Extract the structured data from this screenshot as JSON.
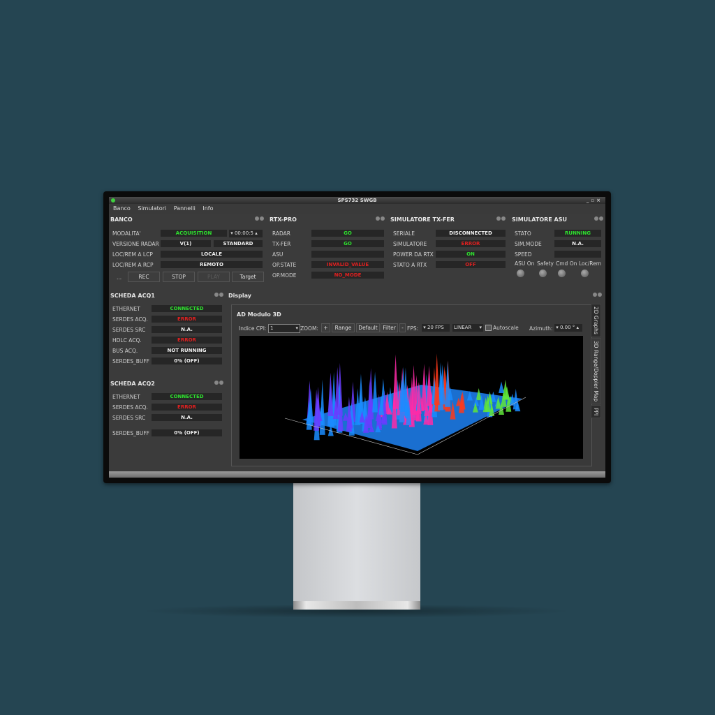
{
  "window": {
    "title": "SPS732 SWGB",
    "controls": [
      "_",
      "▫",
      "×"
    ]
  },
  "menu": [
    "Banco",
    "Simulatori",
    "Pannelli",
    "Info"
  ],
  "banco": {
    "title": "BANCO",
    "rows": [
      {
        "label": "MODALITA'",
        "value": "ACQUISITION",
        "color": "green"
      },
      {
        "label": "VERSIONE RADAR",
        "value": "V(1)",
        "value2": "STANDARD",
        "color": "white"
      },
      {
        "label": "LOC/REM A LCP",
        "value": "LOCALE",
        "color": "white"
      },
      {
        "label": "LOC/REM A RCP",
        "value": "REMOTO",
        "color": "white"
      }
    ],
    "timer": "00:00:5",
    "buttons": {
      "more": "...",
      "rec": "REC",
      "stop": "STOP",
      "play": "PLAY",
      "target": "Target"
    }
  },
  "rtx_pro": {
    "title": "RTX-PRO",
    "rows": [
      {
        "label": "RADAR",
        "value": "GO",
        "color": "green"
      },
      {
        "label": "TX-FER",
        "value": "GO",
        "color": "green"
      },
      {
        "label": "ASU",
        "value": "",
        "color": "white"
      },
      {
        "label": "OP.STATE",
        "value": "INVALID_VALUE",
        "color": "red"
      },
      {
        "label": "OP.MODE",
        "value": "NO_MODE",
        "color": "red"
      }
    ]
  },
  "sim_txfer": {
    "title": "SIMULATORE TX-FER",
    "rows": [
      {
        "label": "SERIALE",
        "value": "DISCONNECTED",
        "color": "white"
      },
      {
        "label": "SIMULATORE",
        "value": "ERROR",
        "color": "red"
      },
      {
        "label": "POWER DA RTX",
        "value": "ON",
        "color": "green"
      },
      {
        "label": "STATO A RTX",
        "value": "OFF",
        "color": "red"
      }
    ]
  },
  "sim_asu": {
    "title": "SIMULATORE ASU",
    "rows": [
      {
        "label": "STATO",
        "value": "RUNNING",
        "color": "green"
      },
      {
        "label": "SIM.MODE",
        "value": "N.A.",
        "color": "white"
      },
      {
        "label": "SPEED",
        "value": "",
        "color": "white"
      }
    ],
    "leds": [
      "ASU On",
      "Safety",
      "Cmd On",
      "Loc/Rem"
    ]
  },
  "acq1": {
    "title": "SCHEDA ACQ1",
    "rows": [
      {
        "label": "ETHERNET",
        "value": "CONNECTED",
        "color": "green"
      },
      {
        "label": "SERDES ACQ.",
        "value": "ERROR",
        "color": "red"
      },
      {
        "label": "SERDES SRC",
        "value": "N.A.",
        "color": "white"
      },
      {
        "label": "HDLC ACQ.",
        "value": "ERROR",
        "color": "red"
      },
      {
        "label": "BUS ACQ.",
        "value": "NOT RUNNING",
        "color": "white"
      },
      {
        "label": "SERDES_BUFF",
        "value": "0% (OFF)",
        "color": "white"
      }
    ]
  },
  "acq2": {
    "title": "SCHEDA ACQ2",
    "rows": [
      {
        "label": "ETHERNET",
        "value": "CONNECTED",
        "color": "green"
      },
      {
        "label": "SERDES ACQ.",
        "value": "ERROR",
        "color": "red"
      },
      {
        "label": "SERDES SRC",
        "value": "N.A.",
        "color": "white"
      },
      {
        "label": "SERDES_BUFF",
        "value": "0% (OFF)",
        "color": "white"
      }
    ]
  },
  "display": {
    "title": "Display",
    "subtitle": "AD Modulo 3D",
    "toolbar": {
      "cpi_label": "Indice CPI:",
      "cpi_value": "1",
      "zoom_label": "ZOOM:",
      "zoom_plus": "+",
      "range": "Range",
      "default": "Default",
      "filter": "Filter",
      "zoom_minus": "-",
      "fps_label": "FPS:",
      "fps_value": "20 FPS",
      "scale_value": "LINEAR",
      "autoscale": "Autoscale",
      "azimuth_label": "Azimuth:",
      "azimuth_value": "0.00 °"
    },
    "tabs": [
      "2D Graphs",
      "3D Range/Doppler Map",
      "PPI"
    ],
    "colors": {
      "low": "#1a8cff",
      "mid": "#6a3cff",
      "high": "#ff2aa8",
      "warm": "#ff3a1a",
      "far": "#5fe63a"
    }
  }
}
